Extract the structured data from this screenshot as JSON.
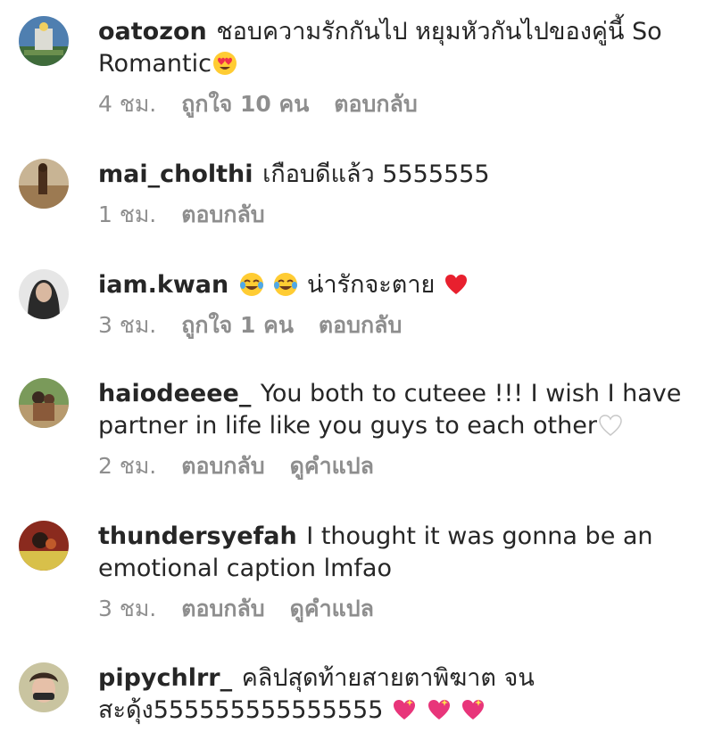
{
  "comments": [
    {
      "username": "oatozon",
      "text": "ชอบความรักกันไป หยุมหัวกันไปของคู่นี้ So Romantic",
      "emoji": [
        "heart-eyes"
      ],
      "time": "4 ชม.",
      "likes": "ถูกใจ 10 คน",
      "reply": "ตอบกลับ"
    },
    {
      "username": "mai_cholthi",
      "text": "เกือบดีแล้ว 5555555",
      "emoji": [],
      "time": "1 ชม.",
      "reply": "ตอบกลับ"
    },
    {
      "username": "iam.kwan",
      "text": "น่ารักจะตาย",
      "emoji": [
        "tears-of-joy",
        "tears-of-joy",
        "red-heart"
      ],
      "time": "3 ชม.",
      "likes": "ถูกใจ 1 คน",
      "reply": "ตอบกลับ"
    },
    {
      "username": "haiodeeee_",
      "text": "You both to cuteee !!! I wish I have partner in life like you guys to each other",
      "emoji": [
        "white-heart"
      ],
      "time": "2 ชม.",
      "reply": "ตอบกลับ",
      "translate": "ดูคำแปล"
    },
    {
      "username": "thundersyefah",
      "text": "I thought it was gonna be an emotional caption lmfao",
      "emoji": [],
      "time": "3 ชม.",
      "reply": "ตอบกลับ",
      "translate": "ดูคำแปล"
    },
    {
      "username": "pipychlrr_",
      "text": "คลิปสุดท้ายสายตาพิฆาต จน สะดุ้ง555555555555555",
      "emoji": [
        "sparkling-heart",
        "sparkling-heart",
        "sparkling-heart"
      ],
      "time": "",
      "reply": ""
    }
  ]
}
